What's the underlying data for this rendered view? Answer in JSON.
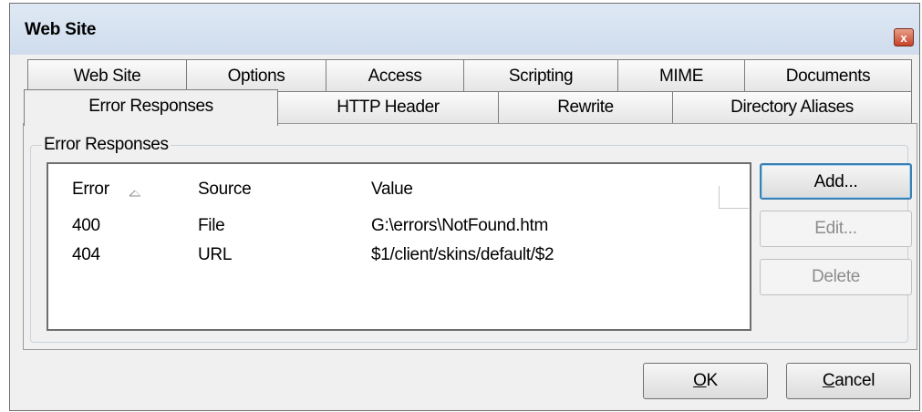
{
  "window": {
    "title": "Web Site",
    "close_glyph": "x"
  },
  "tabs": {
    "row1": [
      "Web Site",
      "Options",
      "Access",
      "Scripting",
      "MIME",
      "Documents"
    ],
    "row2": [
      "Error Responses",
      "HTTP Header",
      "Rewrite",
      "Directory Aliases"
    ],
    "active": "Error Responses"
  },
  "group": {
    "label": "Error Responses"
  },
  "list": {
    "columns": [
      "Error",
      "Source",
      "Value"
    ],
    "sort_column": "Error",
    "sort_icon": "sort-ascending-icon",
    "rows": [
      [
        "400",
        "File",
        "G:\\errors\\NotFound.htm"
      ],
      [
        "404",
        "URL",
        "$1/client/skins/default/$2"
      ]
    ]
  },
  "buttons": {
    "add": "Add...",
    "edit": "Edit...",
    "delete": "Delete",
    "ok_mnemonic": "O",
    "ok_rest": "K",
    "cancel_mnemonic": "C",
    "cancel_rest": "ancel"
  },
  "colors": {
    "titlebar": "#d7e3f1",
    "close": "#c7432a",
    "dialog_bg": "#f0f0f0",
    "default_button_border": "#3c7fb1"
  }
}
